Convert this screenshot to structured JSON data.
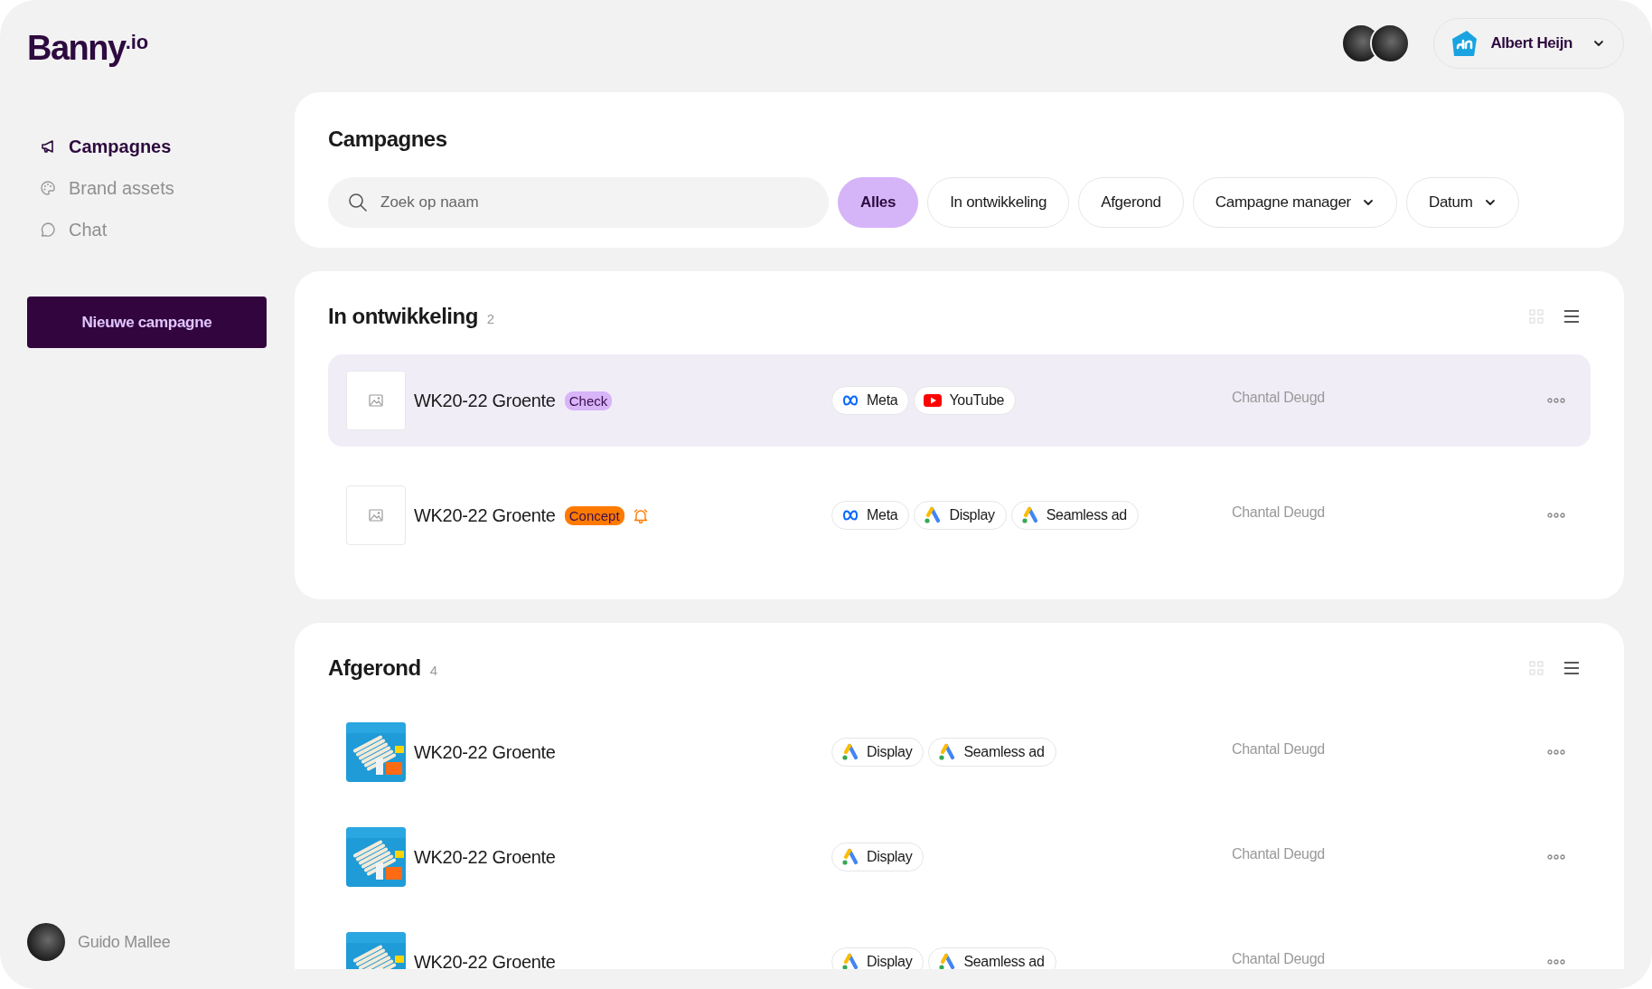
{
  "logo": {
    "text": "Banny",
    "suffix": ".io"
  },
  "sidebar": {
    "items": [
      {
        "label": "Campagnes",
        "selected": true
      },
      {
        "label": "Brand assets",
        "selected": false
      },
      {
        "label": "Chat",
        "selected": false
      }
    ],
    "new_button": "Nieuwe campagne",
    "user": {
      "name": "Guido Mallee"
    }
  },
  "header": {
    "org": {
      "name": "Albert Heijn"
    }
  },
  "campaigns_panel": {
    "title": "Campagnes",
    "search": {
      "placeholder": "Zoek op naam"
    },
    "filters": [
      {
        "label": "Alles",
        "kind": "chip",
        "selected": true
      },
      {
        "label": "In ontwikkeling",
        "kind": "chip",
        "selected": false
      },
      {
        "label": "Afgerond",
        "kind": "chip",
        "selected": false
      },
      {
        "label": "Campagne manager",
        "kind": "dropdown",
        "selected": false
      },
      {
        "label": "Datum",
        "kind": "dropdown",
        "selected": false
      }
    ]
  },
  "sections": [
    {
      "title": "In ontwikkeling",
      "count": "2",
      "views": [
        {
          "kind": "grid",
          "selected": false
        },
        {
          "kind": "list",
          "selected": true
        }
      ],
      "rows": [
        {
          "name": "WK20-22 Groente",
          "thumbnail": {
            "kind": "placeholder"
          },
          "status": {
            "label": "Check",
            "color": "#d8b4f8"
          },
          "alert": false,
          "highlighted": true,
          "channels": [
            {
              "label": "Meta",
              "kind": "meta"
            },
            {
              "label": "YouTube",
              "kind": "youtube"
            }
          ],
          "owner": "Chantal Deugd"
        },
        {
          "name": "WK20-22 Groente",
          "thumbnail": {
            "kind": "placeholder"
          },
          "status": {
            "label": "Concept",
            "color": "#ff7a00"
          },
          "alert": true,
          "highlighted": false,
          "channels": [
            {
              "label": "Meta",
              "kind": "meta"
            },
            {
              "label": "Display",
              "kind": "google_ads"
            },
            {
              "label": "Seamless ad",
              "kind": "google_ads"
            }
          ],
          "owner": "Chantal Deugd"
        }
      ]
    },
    {
      "title": "Afgerond",
      "count": "4",
      "views": [
        {
          "kind": "grid",
          "selected": false
        },
        {
          "kind": "list",
          "selected": true
        }
      ],
      "rows": [
        {
          "name": "WK20-22 Groente",
          "thumbnail": {
            "kind": "picture"
          },
          "alert": false,
          "highlighted": false,
          "channels": [
            {
              "label": "Display",
              "kind": "google_ads"
            },
            {
              "label": "Seamless ad",
              "kind": "google_ads"
            }
          ],
          "owner": "Chantal Deugd"
        },
        {
          "name": "WK20-22 Groente",
          "thumbnail": {
            "kind": "picture"
          },
          "alert": false,
          "highlighted": false,
          "channels": [
            {
              "label": "Display",
              "kind": "google_ads"
            }
          ],
          "owner": "Chantal Deugd"
        },
        {
          "name": "WK20-22 Groente",
          "thumbnail": {
            "kind": "picture"
          },
          "alert": false,
          "highlighted": false,
          "channels": [
            {
              "label": "Display",
              "kind": "google_ads"
            },
            {
              "label": "Seamless ad",
              "kind": "google_ads"
            }
          ],
          "owner": "Chantal Deugd"
        }
      ]
    }
  ]
}
